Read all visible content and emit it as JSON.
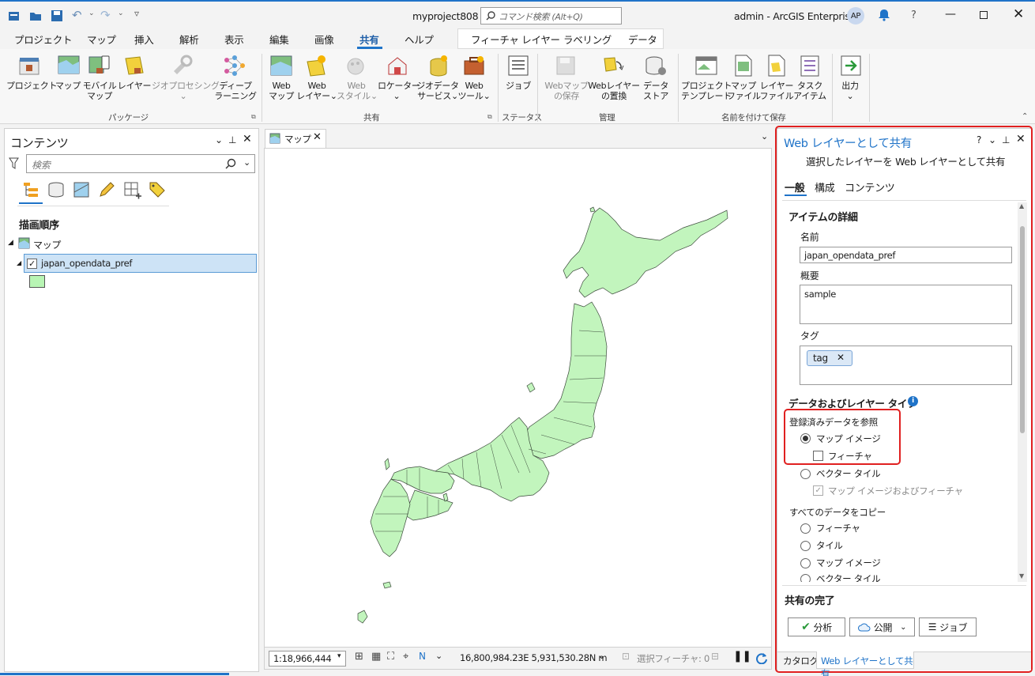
{
  "window": {
    "title": "myproject808",
    "search_placeholder": "コマンド検索 (Alt+Q)",
    "user": "admin - ArcGIS Enterprise",
    "avatar": "AP",
    "help": "?"
  },
  "ribbon": {
    "tabs": [
      "プロジェクト",
      "マップ",
      "挿入",
      "解析",
      "表示",
      "編集",
      "画像",
      "共有",
      "ヘルプ"
    ],
    "context_tabs": [
      "フィーチャ レイヤー",
      "ラベリング",
      "データ"
    ],
    "active_tab": "共有",
    "groups": {
      "package": "パッケージ",
      "share": "共有",
      "status": "ステータス",
      "manage": "管理",
      "save_as": "名前を付けて保存"
    },
    "buttons": {
      "project": "プロジェクト",
      "map": "マップ",
      "mobile_map_1": "モバイル",
      "mobile_map_2": "マップ",
      "layer": "レイヤー",
      "geoprocessing_1": "ジオプロセシング",
      "deep_learning_1": "ディープ",
      "deep_learning_2": "ラーニング",
      "web_map_1": "Web",
      "web_map_2": "マップ",
      "web_layer_1": "Web",
      "web_layer_2": "レイヤー",
      "web_style_1": "Web",
      "web_style_2": "スタイル",
      "locator": "ロケーター",
      "geodata_1": "ジオデータ",
      "geodata_2": "サービス",
      "web_tool_1": "Web",
      "web_tool_2": "ツール",
      "jobs": "ジョブ",
      "save_webmap_1": "Webマップ",
      "save_webmap_2": "の保存",
      "replace_1": "Webレイヤー",
      "replace_2": "の置換",
      "datastore_1": "データ",
      "datastore_2": "ストア",
      "proj_template_1": "プロジェクト",
      "proj_template_2": "テンプレート",
      "map_file_1": "マップ",
      "map_file_2": "ファイル",
      "layer_file_1": "レイヤー",
      "layer_file_2": "ファイル",
      "task_1": "タスク",
      "task_2": "アイテム",
      "output": "出力"
    }
  },
  "contents": {
    "title": "コンテンツ",
    "search_placeholder": "検索",
    "drawing_order": "描画順序",
    "map_node": "マップ",
    "layer_name": "japan_opendata_pref",
    "symbol_color": "#b8f5b4"
  },
  "map_view": {
    "tab": "マップ",
    "scale": "1:18,966,444",
    "coords": "16,800,984.23E 5,931,530.28N m",
    "selected_features": "選択フィーチャ: 0",
    "fill_color": "#c2f5bd"
  },
  "share_pane": {
    "title": "Web レイヤーとして共有",
    "subtitle": "選択したレイヤーを Web レイヤーとして共有",
    "tabs": [
      "一般",
      "構成",
      "コンテンツ"
    ],
    "item_details": "アイテムの詳細",
    "name_label": "名前",
    "name_value": "japan_opendata_pref",
    "summary_label": "概要",
    "summary_value": "sample",
    "tags_label": "タグ",
    "tag": "tag",
    "data_type_header": "データおよびレイヤー タイプ",
    "reference_label": "登録済みデータを参照",
    "ref_options": {
      "map_image": "マップ イメージ",
      "feature": "フィーチャ",
      "vector_tile": "ベクター タイル",
      "map_image_feature": "マップ イメージおよびフィーチャ"
    },
    "copy_label": "すべてのデータをコピー",
    "copy_options": [
      "フィーチャ",
      "タイル",
      "マップ イメージ",
      "ベクター タイル"
    ],
    "finish_header": "共有の完了",
    "analyze": "分析",
    "publish": "公開",
    "jobs": "ジョブ",
    "bottom_tabs": [
      "カタログ",
      "Web レイヤーとして共有"
    ]
  },
  "colors": {
    "accent": "#1f73c8",
    "highlight_red": "#e02020",
    "selected_row": "#cde3f6"
  }
}
